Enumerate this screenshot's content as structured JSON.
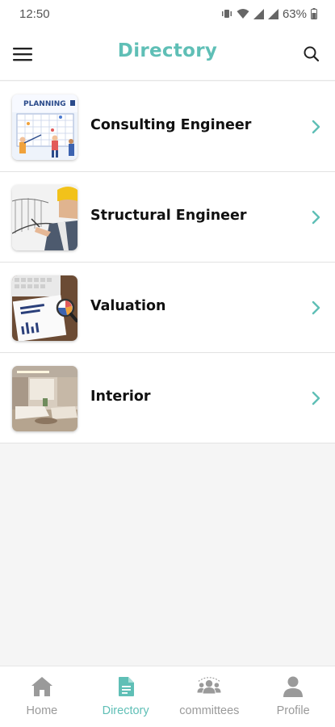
{
  "status_bar": {
    "time": "12:50",
    "battery": "63%",
    "icons": [
      "vibrate-icon",
      "wifi-icon",
      "signal-icon",
      "signal-icon",
      "battery-icon"
    ]
  },
  "app_bar": {
    "title": "Directory",
    "left_icon": "menu-icon",
    "right_icon": "search-icon"
  },
  "directory": {
    "items": [
      {
        "label": "Consulting Engineer",
        "thumb_text": "PLANNING"
      },
      {
        "label": "Structural Engineer"
      },
      {
        "label": "Valuation"
      },
      {
        "label": "Interior"
      }
    ]
  },
  "bottom_nav": {
    "items": [
      {
        "label": "Home",
        "icon": "home-icon"
      },
      {
        "label": "Directory",
        "icon": "document-icon"
      },
      {
        "label": "committees",
        "icon": "group-icon"
      },
      {
        "label": "Profile",
        "icon": "person-icon"
      }
    ],
    "active": "Directory"
  },
  "colors": {
    "accent": "#5fbfb6",
    "inactive": "#9a9a9a",
    "background": "#f5f5f5"
  }
}
